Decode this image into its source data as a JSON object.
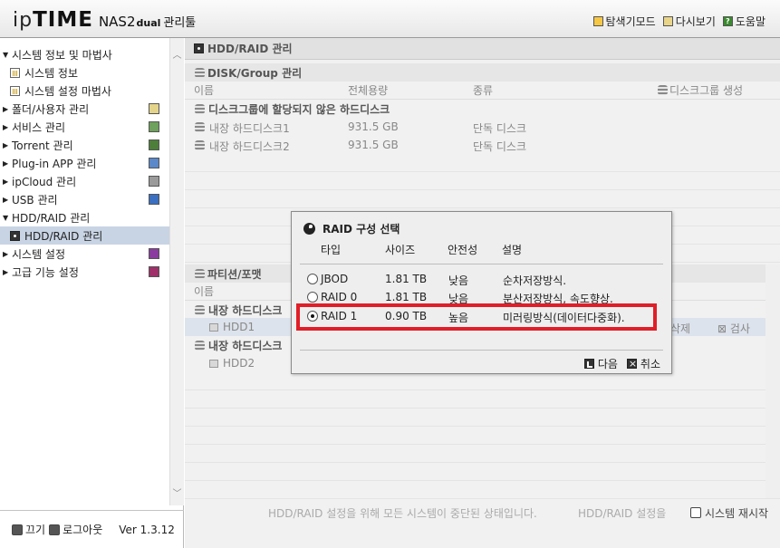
{
  "header": {
    "brand_ip": "ip",
    "brand_time": "TIME",
    "brand_model": "NAS2",
    "brand_dual": "dual",
    "brand_sub": "관리툴",
    "links": [
      {
        "label": "탐색기모드",
        "icon": "folder-icon"
      },
      {
        "label": "다시보기",
        "icon": "refresh-icon"
      },
      {
        "label": "도움말",
        "icon": "help-icon"
      }
    ]
  },
  "sidebar": {
    "items": [
      {
        "label": "시스템 정보 및 마법사",
        "expanded": true
      },
      {
        "label": "시스템 정보"
      },
      {
        "label": "시스템 설정 마법사"
      },
      {
        "label": "폴더/사용자 관리"
      },
      {
        "label": "서비스 관리"
      },
      {
        "label": "Torrent 관리"
      },
      {
        "label": "Plug-in APP 관리"
      },
      {
        "label": "ipCloud 관리"
      },
      {
        "label": "USB 관리"
      },
      {
        "label": "HDD/RAID 관리",
        "expanded": true
      },
      {
        "label": "HDD/RAID 관리",
        "selected": true
      },
      {
        "label": "시스템 설정"
      },
      {
        "label": "고급 기능 설정"
      }
    ],
    "footer": {
      "power": "끄기",
      "logout": "로그아웃",
      "version": "Ver 1.3.12"
    }
  },
  "main": {
    "panel_title": "HDD/RAID 관리",
    "disk_group": {
      "title": "DISK/Group 관리",
      "columns": [
        "이름",
        "전체용량",
        "종류"
      ],
      "create_label": "디스크그룹 생성",
      "unassigned_title": "디스크그룹에 할당되지 않은 하드디스크",
      "rows": [
        {
          "name": "내장 하드디스크1",
          "size": "931.5 GB",
          "type": "단독 디스크"
        },
        {
          "name": "내장 하드디스크2",
          "size": "931.5 GB",
          "type": "단독 디스크"
        }
      ]
    },
    "partition": {
      "title": "파티션/포맷",
      "column_name": "이름",
      "groups": [
        {
          "name": "내장 하드디스크",
          "disk": "HDD1"
        },
        {
          "name": "내장 하드디스크",
          "disk": "HDD2"
        }
      ],
      "delete_label": "삭제",
      "check_label": "검사"
    },
    "status_left": "HDD/RAID 설정을 위해 모든 시스템이 중단된 상태입니다.",
    "status_mid": "HDD/RAID 설정을",
    "status_restart": "시스템 재시작"
  },
  "dialog": {
    "title": "RAID 구성 선택",
    "columns": [
      "타입",
      "사이즈",
      "안전성",
      "설명"
    ],
    "options": [
      {
        "type": "JBOD",
        "size": "1.81 TB",
        "safety": "낮음",
        "desc": "순차저장방식.",
        "selected": false
      },
      {
        "type": "RAID 0",
        "size": "1.81 TB",
        "safety": "낮음",
        "desc": "분산저장방식, 속도향상.",
        "selected": false
      },
      {
        "type": "RAID 1",
        "size": "0.90 TB",
        "safety": "높음",
        "desc": "미러링방식(데이터다중화).",
        "selected": true
      }
    ],
    "next_label": "다음",
    "cancel_label": "취소",
    "highlight_color": "#e01e28"
  }
}
